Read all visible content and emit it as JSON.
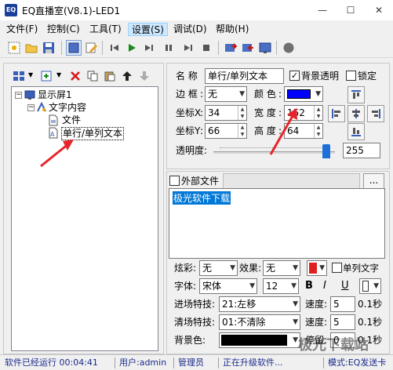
{
  "window": {
    "title": "EQ直播室(V8.1)-LED1",
    "icon_text": "EQ",
    "minimize": "—",
    "maximize": "☐",
    "close": "✕"
  },
  "menu": [
    "文件(F)",
    "控制(C)",
    "工具(T)",
    "设置(S)",
    "调试(D)",
    "帮助(H)"
  ],
  "menu_active_index": 3,
  "tree": {
    "root": "显示屏1",
    "child": "文字内容",
    "leaves": [
      "文件",
      "单行/单列文本"
    ],
    "selected_leaf": "单行/单列文本"
  },
  "props": {
    "name_label": "名 称",
    "name_value": "单行/单列文本",
    "bg_transparent_label": "背景透明",
    "bg_transparent_checked": true,
    "lock_label": "锁定",
    "lock_checked": false,
    "border_label": "边 框",
    "border_value": "无",
    "color_label": "颜 色",
    "color_value": "#0000ff",
    "x_label": "坐标X",
    "x_value": "34",
    "width_label": "宽 度",
    "width_value": "152",
    "y_label": "坐标Y",
    "y_value": "66",
    "height_label": "高 度",
    "height_value": "64",
    "opacity_label": "透明度:",
    "opacity_value": "255",
    "opacity_fraction": 1.0
  },
  "text": {
    "external_file_label": "外部文件",
    "browse_label": "...",
    "content": "极光软件下载",
    "effect_label": "炫彩:",
    "effect_value": "无",
    "fx_label": "效果:",
    "fx_value": "无",
    "fx_color": "#e02020",
    "single_col_label": "单列文字",
    "font_label": "字体:",
    "font_value": "宋体",
    "size_value": "12",
    "bold": "B",
    "italic": "I",
    "underline": "U",
    "enter_label": "进场特技:",
    "enter_value": "21:左移",
    "speed_label": "速度:",
    "enter_speed": "5",
    "enter_unit": "0.1秒",
    "exit_label": "清场特技:",
    "exit_value": "01:不清除",
    "exit_speed_label": "速度:",
    "exit_speed": "5",
    "exit_unit": "0.1秒",
    "bg_label": "背景色:",
    "bg_color": "#000000",
    "stay_label": "停留:",
    "stay_value": "0",
    "stay_unit": "0.1秒"
  },
  "status": {
    "running": "软件已经运行 00:04:41",
    "user": "用户:admin",
    "role": "管理员",
    "upgrading": "正在升级软件...",
    "mode": "模式:EQ发送卡"
  },
  "watermark": "极光下载站",
  "arrow_color": "#e8232a"
}
